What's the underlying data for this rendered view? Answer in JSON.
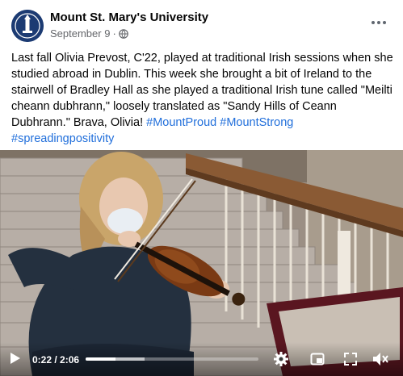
{
  "post": {
    "page_name": "Mount St. Mary's University",
    "date": "September 9",
    "separator": "·",
    "privacy_icon": "globe-icon",
    "more_icon": "more-options-icon",
    "body_text": "Last fall Olivia Prevost, C'22, played at traditional Irish sessions when she studied abroad in Dublin. This week she brought a bit of Ireland to the stairwell of Bradley Hall as she played a traditional Irish tune called \"Meilti cheann dubhrann,\" loosely translated as \"Sandy Hills of Ceann Dubhrann.\" Brava, Olivia!",
    "hashtags": [
      "#MountProud",
      "#MountStrong",
      "#spreadingpositivity"
    ]
  },
  "video": {
    "current_time": "0:22",
    "time_separator": " / ",
    "duration": "2:06",
    "played_fraction": 0.175,
    "buffered_fraction": 0.34,
    "controls": [
      "play-icon",
      "settings-gear-icon",
      "pip-icon",
      "fullscreen-icon",
      "volume-muted-icon"
    ]
  },
  "colors": {
    "hashtag": "#216fdb",
    "meta": "#65676b",
    "avatar_bg": "#1c3b73"
  }
}
